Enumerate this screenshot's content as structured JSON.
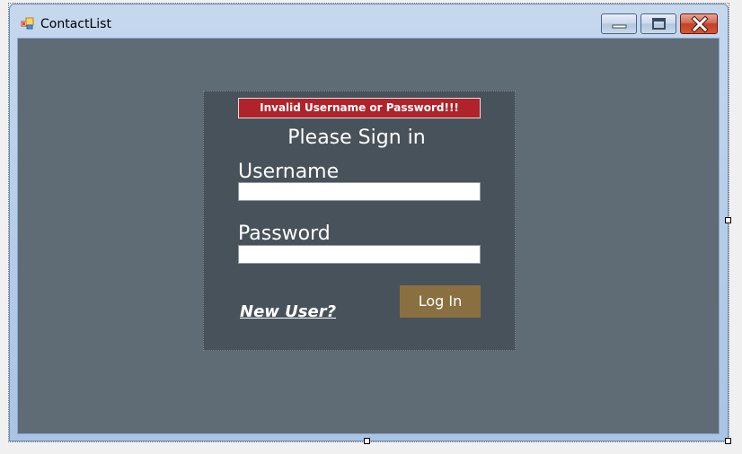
{
  "window": {
    "title": "ContactList",
    "app_icon": "form-icon",
    "controls": {
      "minimize_icon": "minimize-icon",
      "maximize_icon": "maximize-icon",
      "close_icon": "close-icon"
    }
  },
  "login": {
    "error_message": "Invalid Username or Password!!!",
    "heading": "Please Sign in",
    "username_label": "Username",
    "username_value": "",
    "password_label": "Password",
    "password_value": "",
    "new_user_link": "New User?",
    "login_button": "Log In"
  },
  "colors": {
    "client_background": "#5f6b75",
    "panel_background": "#48525a",
    "error_banner": "#b0232a",
    "login_button": "#8a7040"
  }
}
